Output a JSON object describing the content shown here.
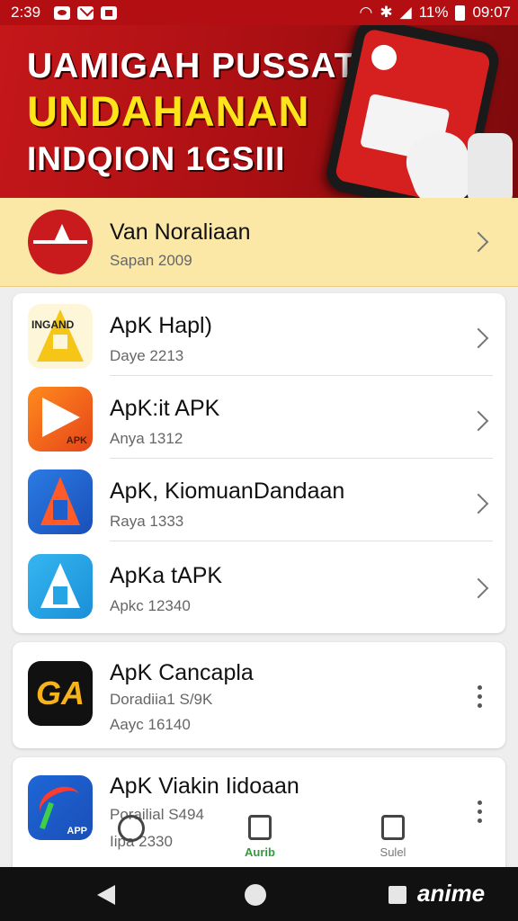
{
  "status_bar": {
    "time": "2:39",
    "battery": "11%",
    "clock": "09:07"
  },
  "banner": {
    "line1": "UAMIGAH PUSSAT",
    "line2": "UNDAHANAN",
    "line3": "INDQION 1GSIII"
  },
  "featured": {
    "title": "Van Noraliaan",
    "subtitle": "Sapan 2009"
  },
  "list1": [
    {
      "title": "ApK Hapl)",
      "subtitle": "Daye 2213",
      "icon": "apk-a-yellow-icon",
      "icon_text": "INGAND"
    },
    {
      "title": "ApK:it APK",
      "subtitle": "Anya 1312",
      "icon": "apk-play-orange-icon",
      "icon_text": "APK"
    },
    {
      "title": "ApK, KiomuanDandaan",
      "subtitle": "Raya 1333",
      "icon": "apk-a-blue-icon",
      "icon_text": ""
    },
    {
      "title": "ApKa tAPK",
      "subtitle": "Apkc 12340",
      "icon": "apk-a-lightblue-icon",
      "icon_text": ""
    }
  ],
  "list2": {
    "title": "ApK Cancapla",
    "sub1": "Doradiia1 S/9K",
    "sub2": "Aayc 16140",
    "icon_text": "GA"
  },
  "list3": {
    "title": "ApK Viakin Iidoaan",
    "sub1": "Porailial S494",
    "sub2": "Iipa 2330",
    "icon_text": "APP"
  },
  "bottom_nav": {
    "tab2": "Aurib",
    "tab3": "Sulel"
  },
  "watermark": "anime",
  "colors": {
    "brand_red": "#b30f12",
    "featured_bg": "#fbe7a6",
    "nav_active": "#2e9e3a"
  }
}
